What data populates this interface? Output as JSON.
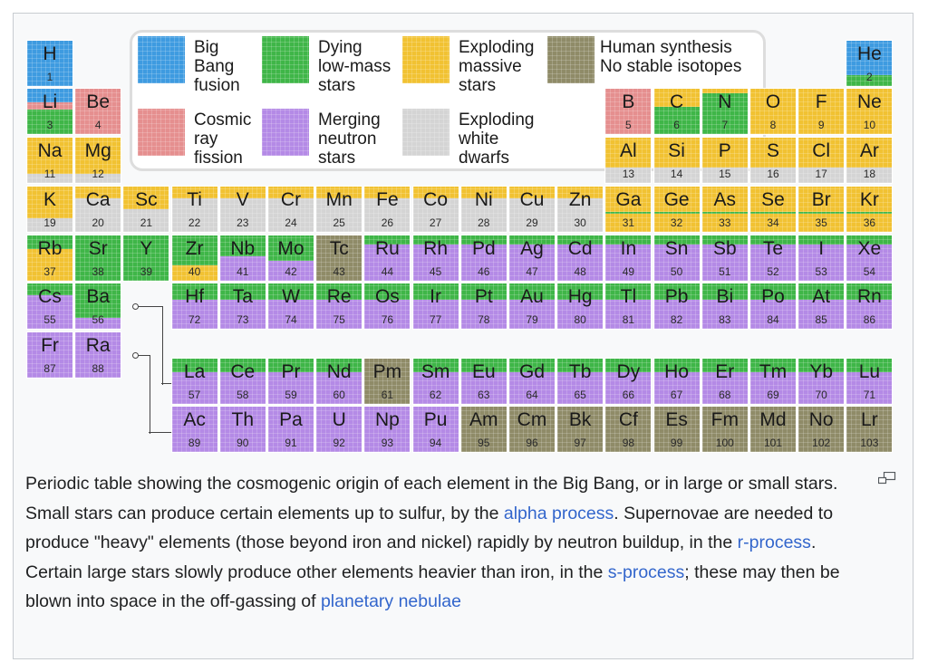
{
  "legend": {
    "big_bang": "Big\nBang\nfusion",
    "dying": "Dying\nlow-mass\nstars",
    "exploding_massive": "Exploding\nmassive\nstars",
    "human": "Human synthesis\nNo stable isotopes",
    "cosmic_ray": "Cosmic\nray\nfission",
    "merging": "Merging\nneutron\nstars",
    "exploding_wd": "Exploding\nwhite\ndwarfs"
  },
  "colors": {
    "big_bang": "#3e9be0",
    "cosmic_ray": "#e58f8f",
    "dying": "#3fb648",
    "exploding_massive": "#f1c232",
    "merging": "#b48ae6",
    "exploding_wd": "#d4d4d4",
    "human": "#8f8b68"
  },
  "elements": [
    {
      "s": "H",
      "n": 1
    },
    {
      "s": "He",
      "n": 2
    },
    {
      "s": "Li",
      "n": 3
    },
    {
      "s": "Be",
      "n": 4
    },
    {
      "s": "B",
      "n": 5
    },
    {
      "s": "C",
      "n": 6
    },
    {
      "s": "N",
      "n": 7
    },
    {
      "s": "O",
      "n": 8
    },
    {
      "s": "F",
      "n": 9
    },
    {
      "s": "Ne",
      "n": 10
    },
    {
      "s": "Na",
      "n": 11
    },
    {
      "s": "Mg",
      "n": 12
    },
    {
      "s": "Al",
      "n": 13
    },
    {
      "s": "Si",
      "n": 14
    },
    {
      "s": "P",
      "n": 15
    },
    {
      "s": "S",
      "n": 16
    },
    {
      "s": "Cl",
      "n": 17
    },
    {
      "s": "Ar",
      "n": 18
    },
    {
      "s": "K",
      "n": 19
    },
    {
      "s": "Ca",
      "n": 20
    },
    {
      "s": "Sc",
      "n": 21
    },
    {
      "s": "Ti",
      "n": 22
    },
    {
      "s": "V",
      "n": 23
    },
    {
      "s": "Cr",
      "n": 24
    },
    {
      "s": "Mn",
      "n": 25
    },
    {
      "s": "Fe",
      "n": 26
    },
    {
      "s": "Co",
      "n": 27
    },
    {
      "s": "Ni",
      "n": 28
    },
    {
      "s": "Cu",
      "n": 29
    },
    {
      "s": "Zn",
      "n": 30
    },
    {
      "s": "Ga",
      "n": 31
    },
    {
      "s": "Ge",
      "n": 32
    },
    {
      "s": "As",
      "n": 33
    },
    {
      "s": "Se",
      "n": 34
    },
    {
      "s": "Br",
      "n": 35
    },
    {
      "s": "Kr",
      "n": 36
    },
    {
      "s": "Rb",
      "n": 37
    },
    {
      "s": "Sr",
      "n": 38
    },
    {
      "s": "Y",
      "n": 39
    },
    {
      "s": "Zr",
      "n": 40
    },
    {
      "s": "Nb",
      "n": 41
    },
    {
      "s": "Mo",
      "n": 42
    },
    {
      "s": "Tc",
      "n": 43
    },
    {
      "s": "Ru",
      "n": 44
    },
    {
      "s": "Rh",
      "n": 45
    },
    {
      "s": "Pd",
      "n": 46
    },
    {
      "s": "Ag",
      "n": 47
    },
    {
      "s": "Cd",
      "n": 48
    },
    {
      "s": "In",
      "n": 49
    },
    {
      "s": "Sn",
      "n": 50
    },
    {
      "s": "Sb",
      "n": 51
    },
    {
      "s": "Te",
      "n": 52
    },
    {
      "s": "I",
      "n": 53
    },
    {
      "s": "Xe",
      "n": 54
    },
    {
      "s": "Cs",
      "n": 55
    },
    {
      "s": "Ba",
      "n": 56
    },
    {
      "s": "Hf",
      "n": 72
    },
    {
      "s": "Ta",
      "n": 73
    },
    {
      "s": "W",
      "n": 74
    },
    {
      "s": "Re",
      "n": 75
    },
    {
      "s": "Os",
      "n": 76
    },
    {
      "s": "Ir",
      "n": 77
    },
    {
      "s": "Pt",
      "n": 78
    },
    {
      "s": "Au",
      "n": 79
    },
    {
      "s": "Hg",
      "n": 80
    },
    {
      "s": "Tl",
      "n": 81
    },
    {
      "s": "Pb",
      "n": 82
    },
    {
      "s": "Bi",
      "n": 83
    },
    {
      "s": "Po",
      "n": 84
    },
    {
      "s": "At",
      "n": 85
    },
    {
      "s": "Rn",
      "n": 86
    },
    {
      "s": "Fr",
      "n": 87
    },
    {
      "s": "Ra",
      "n": 88
    },
    {
      "s": "La",
      "n": 57
    },
    {
      "s": "Ce",
      "n": 58
    },
    {
      "s": "Pr",
      "n": 59
    },
    {
      "s": "Nd",
      "n": 60
    },
    {
      "s": "Pm",
      "n": 61
    },
    {
      "s": "Sm",
      "n": 62
    },
    {
      "s": "Eu",
      "n": 63
    },
    {
      "s": "Gd",
      "n": 64
    },
    {
      "s": "Tb",
      "n": 65
    },
    {
      "s": "Dy",
      "n": 66
    },
    {
      "s": "Ho",
      "n": 67
    },
    {
      "s": "Er",
      "n": 68
    },
    {
      "s": "Tm",
      "n": 69
    },
    {
      "s": "Yb",
      "n": 70
    },
    {
      "s": "Lu",
      "n": 71
    },
    {
      "s": "Ac",
      "n": 89
    },
    {
      "s": "Th",
      "n": 90
    },
    {
      "s": "Pa",
      "n": 91
    },
    {
      "s": "U",
      "n": 92
    },
    {
      "s": "Np",
      "n": 93
    },
    {
      "s": "Pu",
      "n": 94
    },
    {
      "s": "Am",
      "n": 95
    },
    {
      "s": "Cm",
      "n": 96
    },
    {
      "s": "Bk",
      "n": 97
    },
    {
      "s": "Cf",
      "n": 98
    },
    {
      "s": "Es",
      "n": 99
    },
    {
      "s": "Fm",
      "n": 100
    },
    {
      "s": "Md",
      "n": 101
    },
    {
      "s": "No",
      "n": 102
    },
    {
      "s": "Lr",
      "n": 103
    }
  ],
  "caption": {
    "text1": "Periodic table showing the cosmogenic origin of each element in the Big Bang, or in large or small stars. Small stars can produce certain elements up to sulfur, by the ",
    "link1": "alpha process",
    "text2": ". Supernovae are needed to produce \"heavy\" elements (those beyond iron and nickel) rapidly by neutron buildup, in the ",
    "link2": "r-process",
    "text3": ". Certain large stars slowly produce other elements heavier than iron, in the ",
    "link3": "s-process",
    "text4": "; these may then be blown into space in the off-gassing of ",
    "link4": "planetary nebulae"
  }
}
